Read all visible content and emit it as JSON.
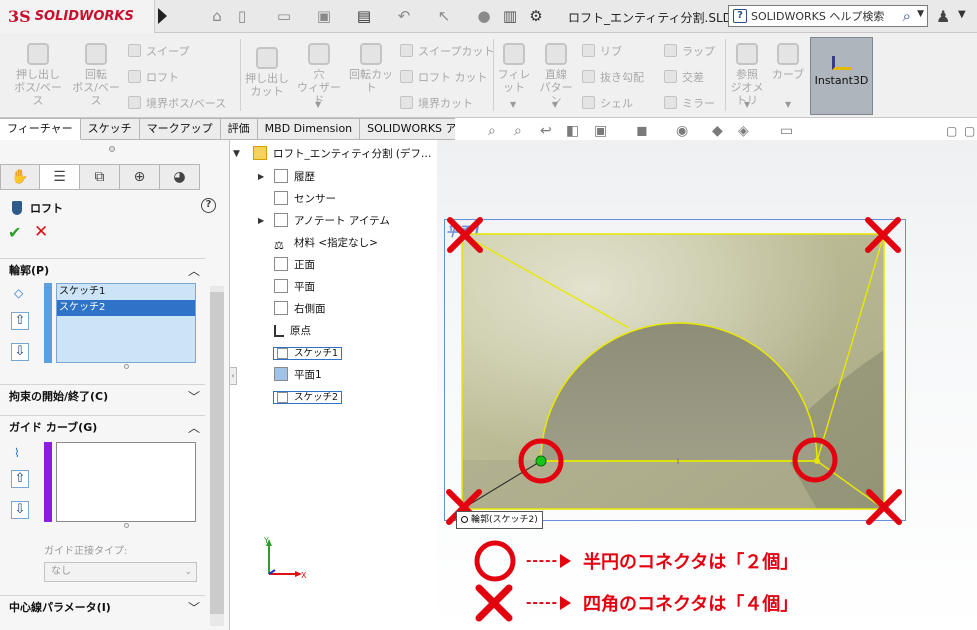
{
  "titlebar": {
    "logo_ds": "3S",
    "logo_text": "SOLIDWORKS",
    "filename": "ロフト_エンティティ分割.SLDP…",
    "help_search": "SOLIDWORKS ヘルプ検索"
  },
  "ribbon": {
    "extrude_boss": [
      "押し出し",
      "ボス/ベース"
    ],
    "revolve_boss": [
      "回転",
      "ボス/ベース"
    ],
    "sweep": "スイープ",
    "loft": "ロフト",
    "boundary_boss": "境界ボス/ベース",
    "extrude_cut": [
      "押し出し",
      "カット"
    ],
    "hole_wizard": [
      "穴",
      "ウィザード"
    ],
    "revolve_cut": "回転カット",
    "sweep_cut": "スイープカット",
    "loft_cut": "ロフト カット",
    "boundary_cut": "境界カット",
    "fillet": "フィレット",
    "linear_pattern": [
      "直線",
      "パターン"
    ],
    "rib": "リブ",
    "draft": "抜き勾配",
    "shell": "シェル",
    "wrap": "ラップ",
    "intersect": "交差",
    "mirror": "ミラー",
    "ref_geometry": [
      "参照",
      "ジオメトリ"
    ],
    "curves": "カーブ",
    "instant3d": "Instant3D"
  },
  "tabs": [
    "フィーチャー",
    "スケッチ",
    "マークアップ",
    "評価",
    "MBD Dimension",
    "SOLIDWORKS アドイン"
  ],
  "panel": {
    "title": "ロフト",
    "help": "?",
    "profile_header": "輪郭(P)",
    "profiles": [
      "スケッチ1",
      "スケッチ2"
    ],
    "start_end_header": "拘束の開始/終了(C)",
    "guide_header": "ガイド カーブ(G)",
    "guide_tangency_label": "ガイド正接タイプ:",
    "guide_tangency_value": "なし",
    "centerline_header": "中心線パラメータ(I)"
  },
  "tree": {
    "root": "ロフト_エンティティ分割 (デフ…",
    "history": "履歴",
    "sensor": "センサー",
    "annotations": "アノテート アイテム",
    "material": "材料 <指定なし>",
    "front": "正面",
    "top": "平面",
    "right": "右側面",
    "origin": "原点",
    "sketch1": "スケッチ1",
    "plane1": "平面1",
    "sketch2": "スケッチ2"
  },
  "viewport": {
    "plane_label": "平面1",
    "tooltip": "輪郭(スケッチ2)",
    "axis_y": "Y",
    "axis_x": "X"
  },
  "annotations": {
    "circle_text": "半円のコネクタは「２個」",
    "cross_text": "四角のコネクタは「４個」"
  },
  "colors": {
    "annotation_red": "#e3000f",
    "selection_blue": "#2f73c9",
    "preview_yellow": "#f0f000"
  }
}
